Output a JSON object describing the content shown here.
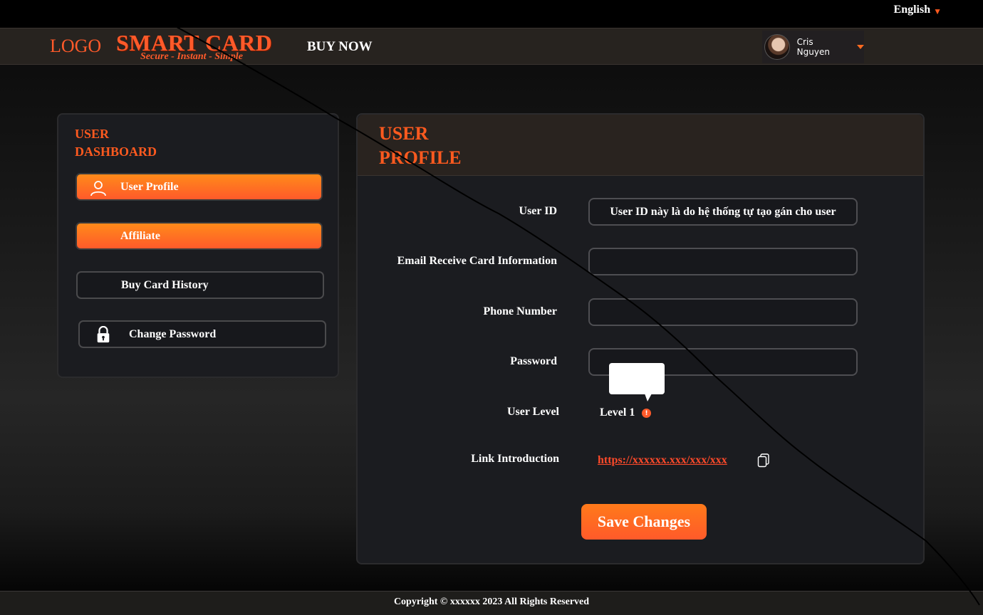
{
  "top_bar": {
    "language": "English"
  },
  "header": {
    "logo": "LOGO",
    "brand_title": "SMART CARD",
    "brand_tagline": "Secure - Instant - Simple",
    "buy_now": "BUY NOW",
    "user_name": "Cris Nguyen"
  },
  "sidebar": {
    "title": "USER DASHBOARD",
    "items": [
      {
        "label": "User Profile",
        "icon": "user-icon",
        "active": true
      },
      {
        "label": "Affiliate",
        "icon": "",
        "active": true
      },
      {
        "label": "Buy Card History",
        "icon": "",
        "active": false
      },
      {
        "label": "Change Password",
        "icon": "lock-icon",
        "active": false
      }
    ]
  },
  "profile": {
    "title": "USER PROFILE",
    "fields": {
      "user_id_label": "User ID",
      "user_id_value": "User ID này là do hệ thống tự tạo gán cho user",
      "email_label": "Email Receive Card Information",
      "email_value": "",
      "phone_label": "Phone Number",
      "phone_value": "",
      "password_label": "Password",
      "password_value": "",
      "level_label": "User Level",
      "level_value": "Level 1",
      "link_label": "Link Introduction",
      "link_value": "https://xxxxxx.xxx/xxx/xxx"
    },
    "save_label": "Save Changes"
  },
  "footer": {
    "copyright": "Copyright © xxxxxx 2023 All Rights Reserved"
  },
  "colors": {
    "accent": "#ff5a1f",
    "accent_gradient_top": "#ff8a1a",
    "panel_bg": "#1b1c20",
    "header_bg": "#27231f"
  }
}
